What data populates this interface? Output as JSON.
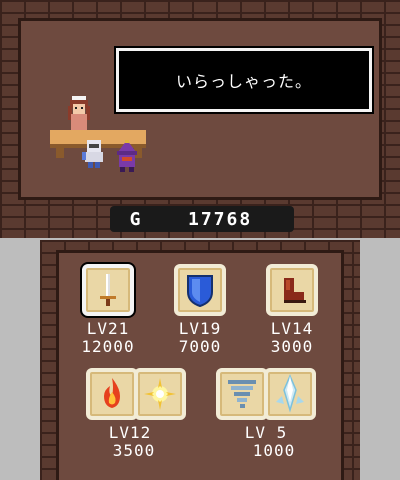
{
  "dialog": {
    "text": "いらっしゃった。"
  },
  "gold": {
    "label": "G",
    "value": "17768"
  },
  "shop": {
    "items": [
      {
        "name": "sword",
        "level": "LV21",
        "price": "12000"
      },
      {
        "name": "shield",
        "level": "LV19",
        "price": "7000"
      },
      {
        "name": "boots",
        "level": "LV14",
        "price": "3000"
      }
    ],
    "spells": [
      {
        "names": [
          "fire",
          "flash"
        ],
        "level": "LV12",
        "price": "3500"
      },
      {
        "names": [
          "tornado",
          "ice"
        ],
        "level": "LV 5",
        "price": "1000"
      }
    ]
  }
}
